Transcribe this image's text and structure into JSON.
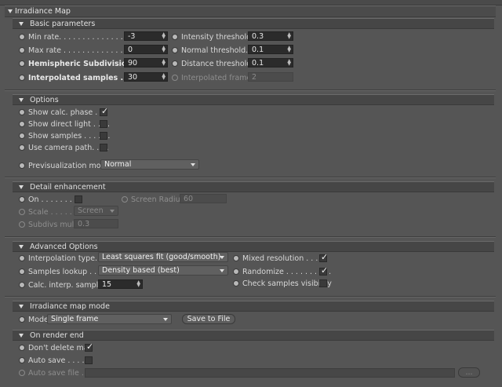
{
  "title": "Irradiance Map",
  "sections": {
    "basic": "Basic parameters",
    "options": "Options",
    "detail": "Detail enhancement",
    "advanced": "Advanced Options",
    "mode": "Irradiance map mode",
    "render_end": "On render end"
  },
  "basic": {
    "min_rate_label": "Min rate. . . . . . . . . . . . . . . . .",
    "min_rate": "-3",
    "max_rate_label": "Max rate . . . . . . . . . . . . . . . .",
    "max_rate": "0",
    "hemi_label": "Hemispheric Subdivision",
    "hemi": "90",
    "interp_label": "Interpolated samples . . .",
    "interp": "30",
    "intensity_label": "Intensity threshold",
    "intensity": "0.3",
    "normal_label": "Normal threshold. . .",
    "normal": "0.1",
    "distance_label": "Distance threshold",
    "distance": "0.1",
    "frames_label": "Interpolated frames",
    "frames": "2"
  },
  "options": {
    "show_calc_label": "Show calc. phase . . .",
    "show_calc_checked": true,
    "show_direct_label": "Show direct light . . . .",
    "show_direct_checked": false,
    "show_samples_label": "Show samples . . . . . .",
    "show_samples_checked": false,
    "camera_path_label": "Use camera path. . . .",
    "camera_path_checked": false,
    "previs_label": "Previsualization mode",
    "previs_value": "Normal"
  },
  "detail": {
    "on_label": "On . . . . . . . . .",
    "on_checked": false,
    "radius_label": "Screen Radius",
    "radius": "60",
    "scale_label": "Scale . . . . . .",
    "scale_value": "Screen",
    "subdivs_label": "Subdivs mult.",
    "subdivs": "0.3"
  },
  "advanced": {
    "interp_type_label": "Interpolation type. . .",
    "interp_type_value": "Least squares fit (good/smooth)",
    "lookup_label": "Samples lookup . . . .",
    "lookup_value": "Density based (best)",
    "calc_interp_label": "Calc. interp. samples",
    "calc_interp": "15",
    "mixed_label": "Mixed resolution . . . . .",
    "mixed_checked": true,
    "randomize_label": "Randomize . . . . . . . . . .",
    "randomize_checked": true,
    "check_vis_label": "Check samples visibility",
    "check_vis_checked": false
  },
  "mode": {
    "mode_label": "Mode",
    "mode_value": "Single frame",
    "save_label": "Save to File"
  },
  "render_end": {
    "dont_delete_label": "Don't delete map",
    "dont_delete_checked": true,
    "auto_save_label": "Auto save . . . . .",
    "auto_save_checked": false,
    "auto_save_file_label": "Auto save file . .",
    "browse_label": "..."
  }
}
